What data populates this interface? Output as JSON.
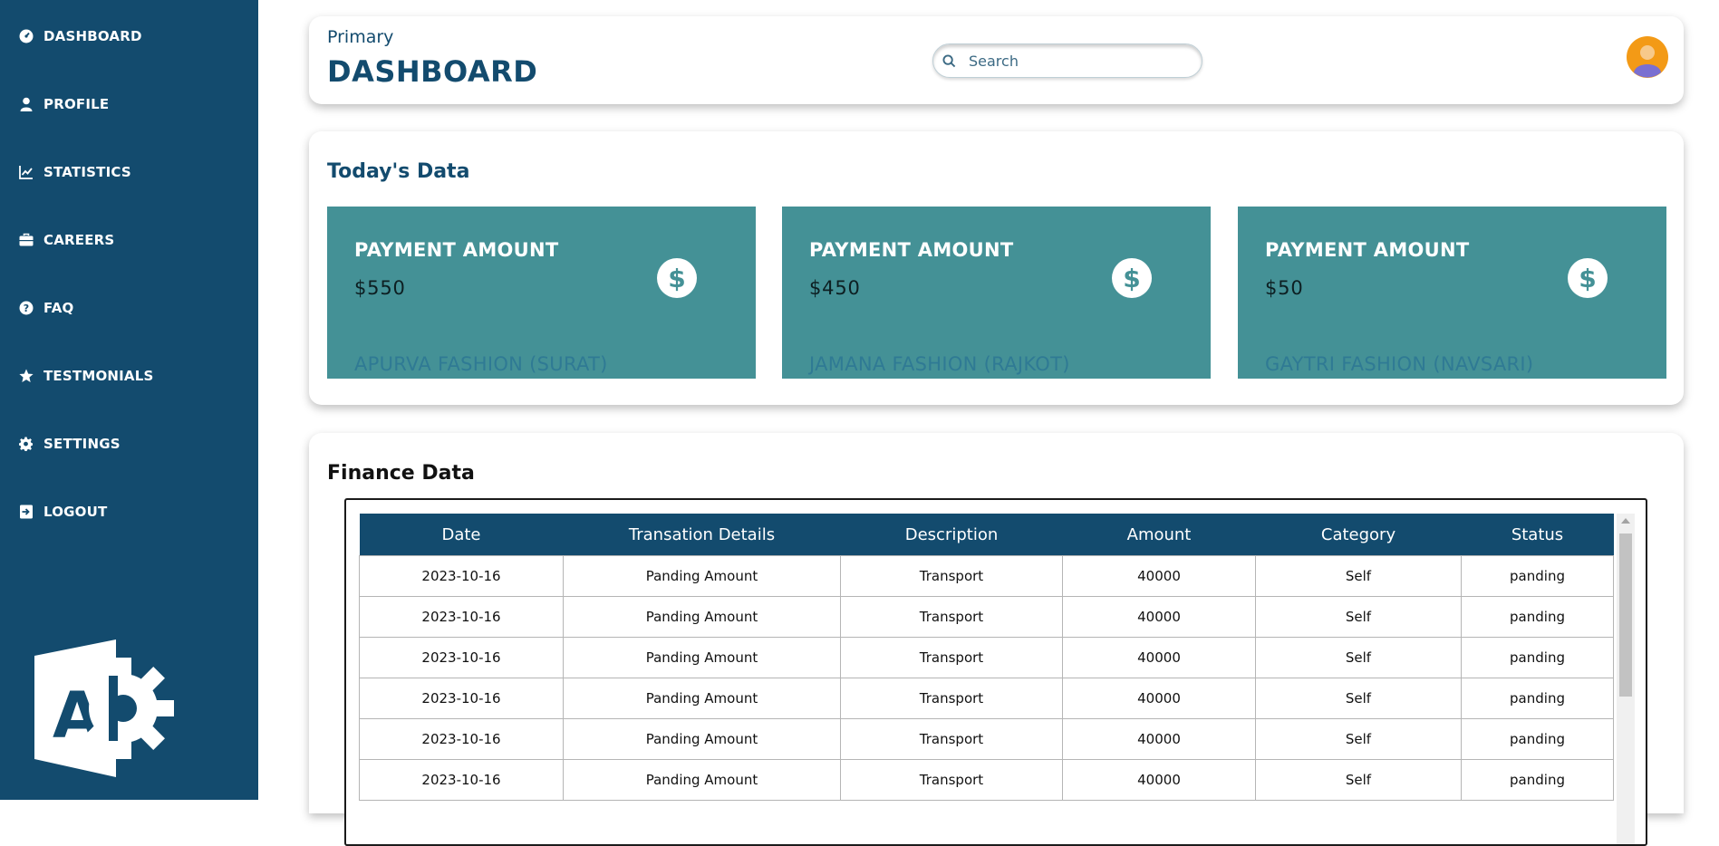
{
  "sidebar": {
    "items": [
      {
        "label": "DASHBOARD",
        "icon": "dashboard-icon"
      },
      {
        "label": "PROFILE",
        "icon": "user-icon"
      },
      {
        "label": "STATISTICS",
        "icon": "chart-line-icon"
      },
      {
        "label": "CAREERS",
        "icon": "briefcase-icon"
      },
      {
        "label": "FAQ",
        "icon": "question-circle-icon"
      },
      {
        "label": "TESTMONIALS",
        "icon": "star-icon"
      },
      {
        "label": "SETTINGS",
        "icon": "gear-icon"
      },
      {
        "label": "LOGOUT",
        "icon": "logout-icon"
      }
    ],
    "logo": "app-logo",
    "logo_letter": "A"
  },
  "header": {
    "subtitle": "Primary",
    "title": "DASHBOARD",
    "search_placeholder": "Search"
  },
  "today": {
    "title": "Today's Data",
    "cards": [
      {
        "label": "PAYMENT AMOUNT",
        "amount": "$550",
        "company": "APURVA FASHION (SURAT)",
        "icon": "$"
      },
      {
        "label": "PAYMENT AMOUNT",
        "amount": "$450",
        "company": "JAMANA FASHION (RAJKOT)",
        "icon": "$"
      },
      {
        "label": "PAYMENT AMOUNT",
        "amount": "$50",
        "company": "GAYTRI FASHION (NAVSARI)",
        "icon": "$"
      }
    ]
  },
  "finance": {
    "title": "Finance Data",
    "columns": [
      "Date",
      "Transation Details",
      "Description",
      "Amount",
      "Category",
      "Status"
    ],
    "rows": [
      [
        "2023-10-16",
        "Panding Amount",
        "Transport",
        "40000",
        "Self",
        "panding"
      ],
      [
        "2023-10-16",
        "Panding Amount",
        "Transport",
        "40000",
        "Self",
        "panding"
      ],
      [
        "2023-10-16",
        "Panding Amount",
        "Transport",
        "40000",
        "Self",
        "panding"
      ],
      [
        "2023-10-16",
        "Panding Amount",
        "Transport",
        "40000",
        "Self",
        "panding"
      ],
      [
        "2023-10-16",
        "Panding Amount",
        "Transport",
        "40000",
        "Self",
        "panding"
      ],
      [
        "2023-10-16",
        "Panding Amount",
        "Transport",
        "40000",
        "Self",
        "panding"
      ]
    ]
  },
  "colors": {
    "sidebar": "#134b6e",
    "card_teal": "#449196",
    "accent": "#134b6e"
  }
}
